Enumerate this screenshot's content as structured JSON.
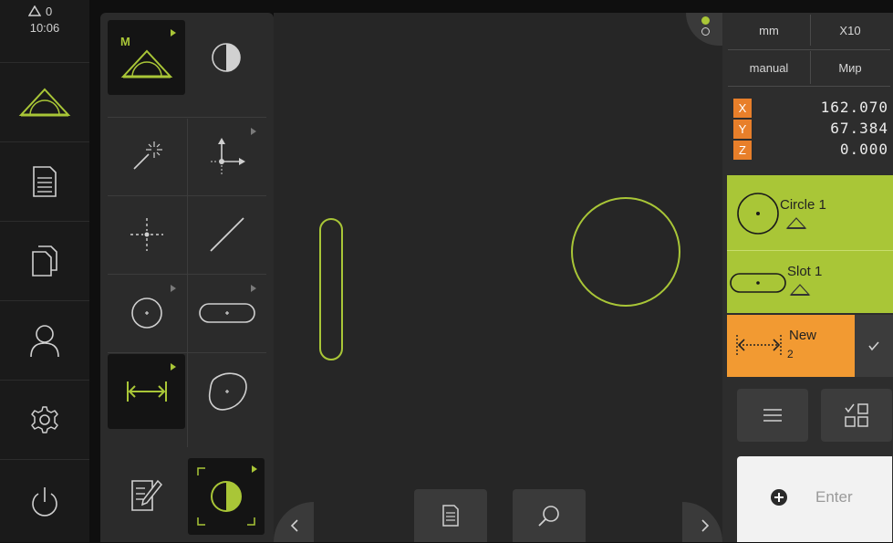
{
  "status": {
    "delta": "0",
    "time": "10:06"
  },
  "inspector": {
    "unit": "mm",
    "zoom": "X10",
    "mode": "manual",
    "coord_system": "Мир",
    "positions": [
      {
        "axis": "X",
        "value": "162.070"
      },
      {
        "axis": "Y",
        "value": "67.384"
      },
      {
        "axis": "Z",
        "value": "0.000"
      }
    ],
    "features": [
      {
        "name": "Circle 1",
        "type": "circle"
      },
      {
        "name": "Slot 1",
        "type": "slot"
      }
    ],
    "new_feature": {
      "name": "New",
      "count": "2"
    },
    "enter_label": "Enter"
  },
  "palette": {
    "manual_badge": "M"
  },
  "colors": {
    "accent": "#a9c637",
    "feature": "#a9c637",
    "new": "#f29a32",
    "axis": "#e87f2a"
  },
  "icons": [
    "delta-icon",
    "measure-icon",
    "report-icon",
    "file-icon",
    "user-icon",
    "gear-icon",
    "power-icon"
  ]
}
